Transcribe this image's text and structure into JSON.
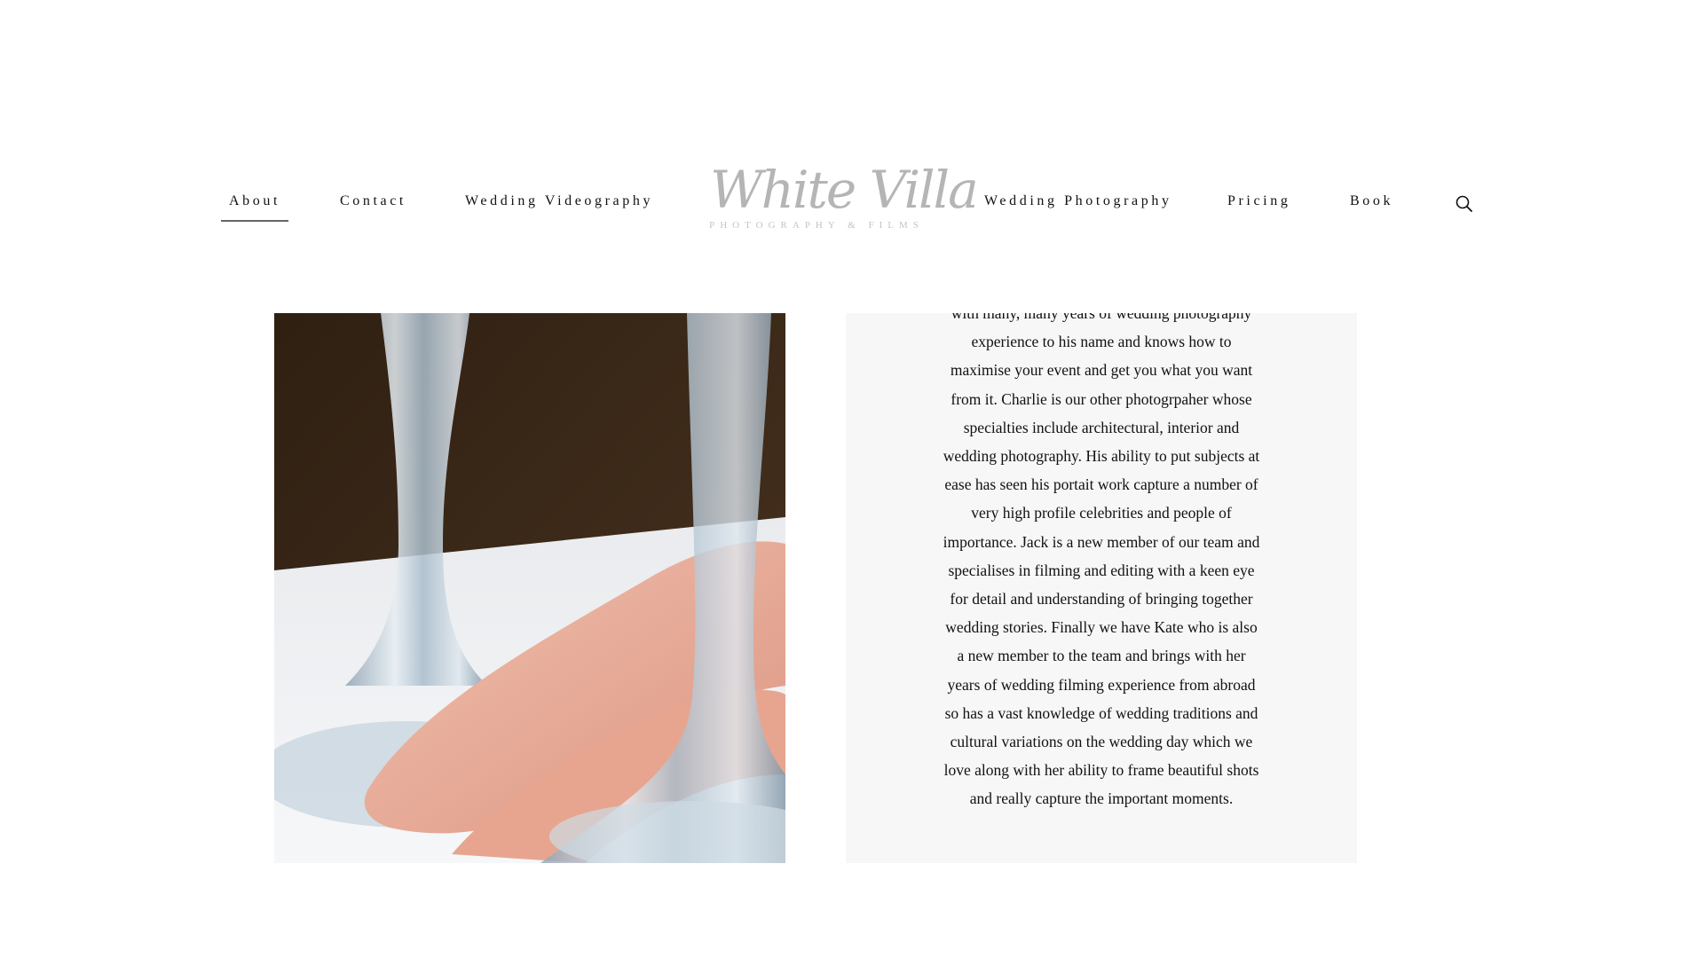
{
  "nav": {
    "left": [
      {
        "label": "About",
        "active": true
      },
      {
        "label": "Contact"
      },
      {
        "label": "Wedding Videography"
      }
    ],
    "right": [
      {
        "label": "Wedding Photography"
      },
      {
        "label": "Pricing"
      },
      {
        "label": "Book"
      }
    ],
    "search_icon": "search-icon"
  },
  "logo": {
    "script": "White Villa",
    "tagline": "PHOTOGRAPHY & FILMS"
  },
  "photo": {
    "subject": "hand between champagne glass stems",
    "colors": {
      "background": "#3d2a17",
      "table": "#f2f3f5",
      "skin": "#e8a995",
      "glass": "#b9c9d6"
    }
  },
  "about_text": {
    "lines": [
      "with many, many years of wedding photography",
      "experience to his name and knows how to",
      "maximise your event and get you what you want",
      "from it. Charlie is our other photogrpaher whose",
      "specialties include architectural, interior and",
      "wedding photography. His ability to put subjects at",
      "ease has seen his portait work capture a number of",
      "very high profile celebrities and people of",
      "importance. Jack is a new member of our team and",
      "specialises in filming and editing with a keen eye",
      "for detail and understanding of bringing together",
      "wedding stories. Finally we have Kate who is also",
      "a new member to the team and brings with her",
      "years of wedding filming experience from abroad",
      "so has a vast knowledge of wedding traditions and",
      "cultural variations on the wedding day which we",
      "love along with her ability to frame beautiful shots",
      "and really capture the important moments."
    ]
  }
}
